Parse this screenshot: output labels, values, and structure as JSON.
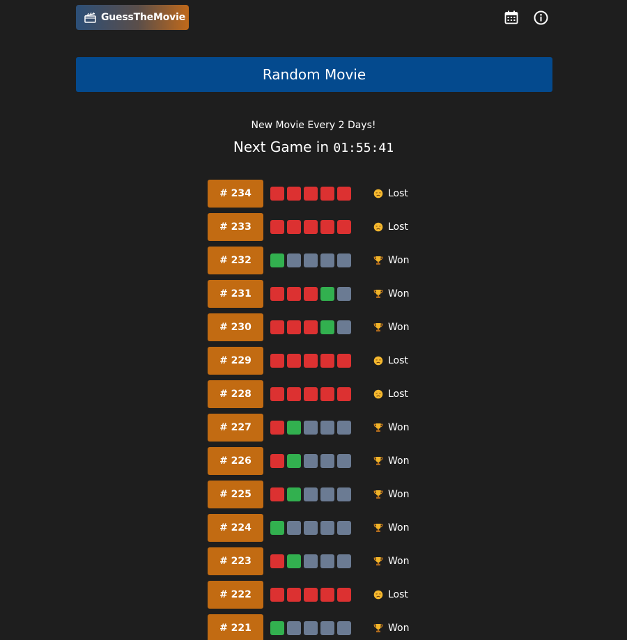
{
  "header": {
    "logo_text": "GuessTheMovie",
    "logo_icon": "clapperboard-icon",
    "calendar_icon": "calendar-icon",
    "info_icon": "info-icon"
  },
  "random_button": {
    "label": "Random Movie"
  },
  "schedule": {
    "subtitle": "New Movie Every 2 Days!",
    "next_game_label": "Next Game in",
    "countdown": "01:55:41"
  },
  "colors": {
    "miss": "#dc3131",
    "hit": "#32b04f",
    "unused": "#6b7b93",
    "game_badge": "#c26b12",
    "random_button": "#044a8e"
  },
  "games": [
    {
      "number": "# 234",
      "squares": [
        "miss",
        "miss",
        "miss",
        "miss",
        "miss"
      ],
      "result": "Lost",
      "result_icon": "sad-face-icon"
    },
    {
      "number": "# 233",
      "squares": [
        "miss",
        "miss",
        "miss",
        "miss",
        "miss"
      ],
      "result": "Lost",
      "result_icon": "sad-face-icon"
    },
    {
      "number": "# 232",
      "squares": [
        "hit",
        "unused",
        "unused",
        "unused",
        "unused"
      ],
      "result": "Won",
      "result_icon": "trophy-icon"
    },
    {
      "number": "# 231",
      "squares": [
        "miss",
        "miss",
        "miss",
        "hit",
        "unused"
      ],
      "result": "Won",
      "result_icon": "trophy-icon"
    },
    {
      "number": "# 230",
      "squares": [
        "miss",
        "miss",
        "miss",
        "hit",
        "unused"
      ],
      "result": "Won",
      "result_icon": "trophy-icon"
    },
    {
      "number": "# 229",
      "squares": [
        "miss",
        "miss",
        "miss",
        "miss",
        "miss"
      ],
      "result": "Lost",
      "result_icon": "sad-face-icon"
    },
    {
      "number": "# 228",
      "squares": [
        "miss",
        "miss",
        "miss",
        "miss",
        "miss"
      ],
      "result": "Lost",
      "result_icon": "sad-face-icon"
    },
    {
      "number": "# 227",
      "squares": [
        "miss",
        "hit",
        "unused",
        "unused",
        "unused"
      ],
      "result": "Won",
      "result_icon": "trophy-icon"
    },
    {
      "number": "# 226",
      "squares": [
        "miss",
        "hit",
        "unused",
        "unused",
        "unused"
      ],
      "result": "Won",
      "result_icon": "trophy-icon"
    },
    {
      "number": "# 225",
      "squares": [
        "miss",
        "hit",
        "unused",
        "unused",
        "unused"
      ],
      "result": "Won",
      "result_icon": "trophy-icon"
    },
    {
      "number": "# 224",
      "squares": [
        "hit",
        "unused",
        "unused",
        "unused",
        "unused"
      ],
      "result": "Won",
      "result_icon": "trophy-icon"
    },
    {
      "number": "# 223",
      "squares": [
        "miss",
        "hit",
        "unused",
        "unused",
        "unused"
      ],
      "result": "Won",
      "result_icon": "trophy-icon"
    },
    {
      "number": "# 222",
      "squares": [
        "miss",
        "miss",
        "miss",
        "miss",
        "miss"
      ],
      "result": "Lost",
      "result_icon": "sad-face-icon"
    },
    {
      "number": "# 221",
      "squares": [
        "hit",
        "unused",
        "unused",
        "unused",
        "unused"
      ],
      "result": "Won",
      "result_icon": "trophy-icon"
    }
  ]
}
